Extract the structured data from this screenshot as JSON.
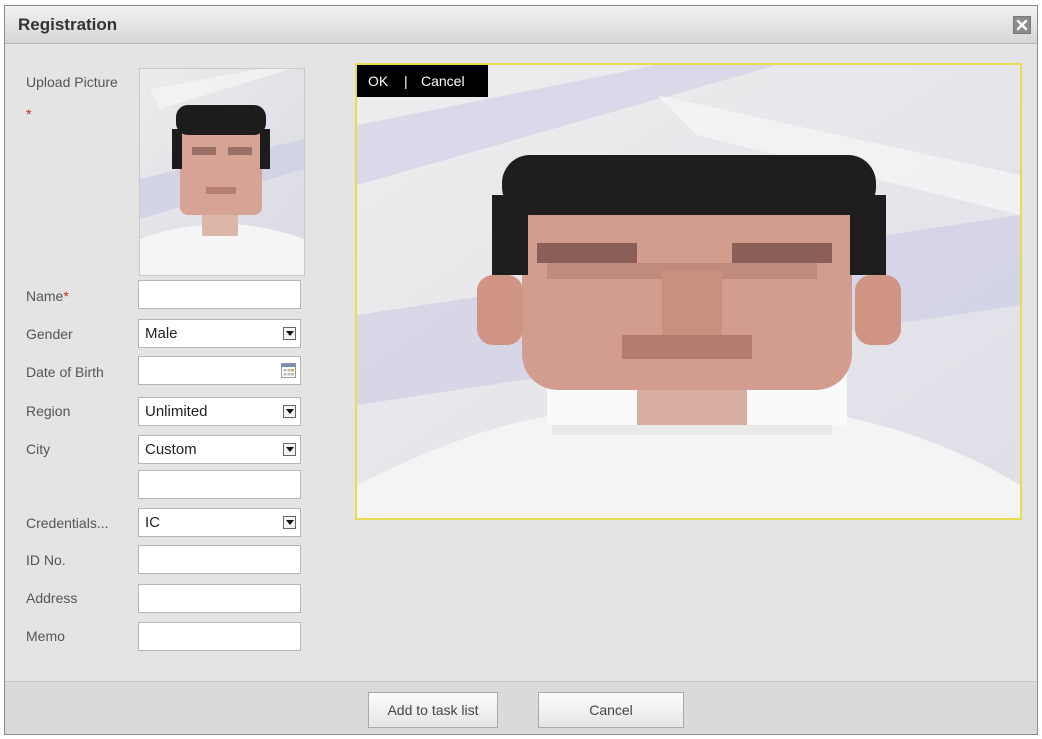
{
  "dialog": {
    "title": "Registration",
    "close_icon": "close-icon"
  },
  "form": {
    "upload_label": "Upload Picture",
    "upload_required_mark": "*",
    "name_label": "Name",
    "name_required_mark": "*",
    "name_value": "",
    "gender_label": "Gender",
    "gender_value": "Male",
    "dob_label": "Date of Birth",
    "dob_value": "",
    "region_label": "Region",
    "region_value": "Unlimited",
    "city_label": "City",
    "city_value": "Custom",
    "city_custom_value": "",
    "credentials_label": "Credentials...",
    "credentials_value": "IC",
    "id_label": "ID No.",
    "id_value": "",
    "address_label": "Address",
    "address_value": "",
    "memo_label": "Memo",
    "memo_value": ""
  },
  "crop": {
    "ok_label": "OK",
    "separator": "|",
    "cancel_label": "Cancel"
  },
  "footer": {
    "add_label": "Add to task list",
    "cancel_label": "Cancel"
  },
  "colors": {
    "crop_border": "#e8dc52",
    "required": "#d02020",
    "dialog_bg": "#e4e4e4"
  }
}
